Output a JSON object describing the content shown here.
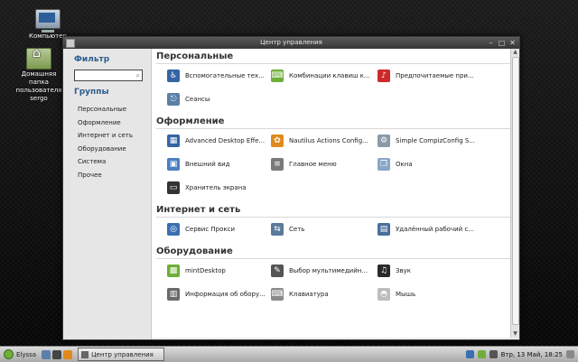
{
  "desktop": {
    "icons": [
      {
        "label": "Компьютер"
      },
      {
        "label": "Домашняя папка пользователя sergo"
      }
    ]
  },
  "window": {
    "title": "Центр управления"
  },
  "sidebar": {
    "filter_heading": "Фильтр",
    "filter_value": "",
    "groups_heading": "Группы",
    "groups": [
      "Персональные",
      "Оформление",
      "Интернет и сеть",
      "Оборудование",
      "Система",
      "Прочее"
    ]
  },
  "sections": [
    {
      "title": "Персональные",
      "items": [
        {
          "label": "Вспомогательные тех...",
          "icon": "accessibility-icon",
          "color": "#3465a4",
          "glyph": "♿"
        },
        {
          "label": "Комбинации клавиш к...",
          "icon": "keyboard-shortcuts-icon",
          "color": "#6fae3b",
          "glyph": "⌨"
        },
        {
          "label": "Предпочитаемые при...",
          "icon": "preferred-apps-icon",
          "color": "#cc2a2a",
          "glyph": "♪"
        },
        {
          "label": "Сеансы",
          "icon": "sessions-icon",
          "color": "#5b7fa8",
          "glyph": "⎋"
        }
      ]
    },
    {
      "title": "Оформление",
      "items": [
        {
          "label": "Advanced Desktop Effe...",
          "icon": "desktop-effects-icon",
          "color": "#3465a4",
          "glyph": "▦"
        },
        {
          "label": "Nautilus Actions Config...",
          "icon": "nautilus-actions-icon",
          "color": "#e08a1e",
          "glyph": "✿"
        },
        {
          "label": "Simple CompizConfig S...",
          "icon": "compizconfig-icon",
          "color": "#8a9aaa",
          "glyph": "⚙"
        },
        {
          "label": "Внешний вид",
          "icon": "appearance-icon",
          "color": "#4a7fc1",
          "glyph": "▣"
        },
        {
          "label": "Главное меню",
          "icon": "main-menu-icon",
          "color": "#7a7a7a",
          "glyph": "≡"
        },
        {
          "label": "Окна",
          "icon": "windows-icon",
          "color": "#8aa6c8",
          "glyph": "❐"
        },
        {
          "label": "Хранитель экрана",
          "icon": "screensaver-icon",
          "color": "#333333",
          "glyph": "▭"
        }
      ]
    },
    {
      "title": "Интернет и сеть",
      "items": [
        {
          "label": "Сервис Прокси",
          "icon": "proxy-icon",
          "color": "#3a6fb0",
          "glyph": "◎"
        },
        {
          "label": "Сеть",
          "icon": "network-icon",
          "color": "#5a7a9a",
          "glyph": "⇆"
        },
        {
          "label": "Удалённый рабочий с...",
          "icon": "remote-desktop-icon",
          "color": "#4a6f9a",
          "glyph": "▤"
        }
      ]
    },
    {
      "title": "Оборудование",
      "items": [
        {
          "label": "mintDesktop",
          "icon": "mintdesktop-icon",
          "color": "#6fae3b",
          "glyph": "▩"
        },
        {
          "label": "Выбор мультимедийн...",
          "icon": "multimedia-icon",
          "color": "#555555",
          "glyph": "✎"
        },
        {
          "label": "Звук",
          "icon": "sound-icon",
          "color": "#2a2a2a",
          "glyph": "♫"
        },
        {
          "label": "Информация об обору...",
          "icon": "hardware-info-icon",
          "color": "#6a6a6a",
          "glyph": "▥"
        },
        {
          "label": "Клавиатура",
          "icon": "keyboard-icon",
          "color": "#8a8a8a",
          "glyph": "⌨"
        },
        {
          "label": "Мышь",
          "icon": "mouse-icon",
          "color": "#bdbdbd",
          "glyph": "◓"
        }
      ]
    }
  ],
  "taskbar": {
    "user": "Elyssa",
    "task": "Центр управления",
    "clock": "Втр, 13 Май, 18:25"
  }
}
